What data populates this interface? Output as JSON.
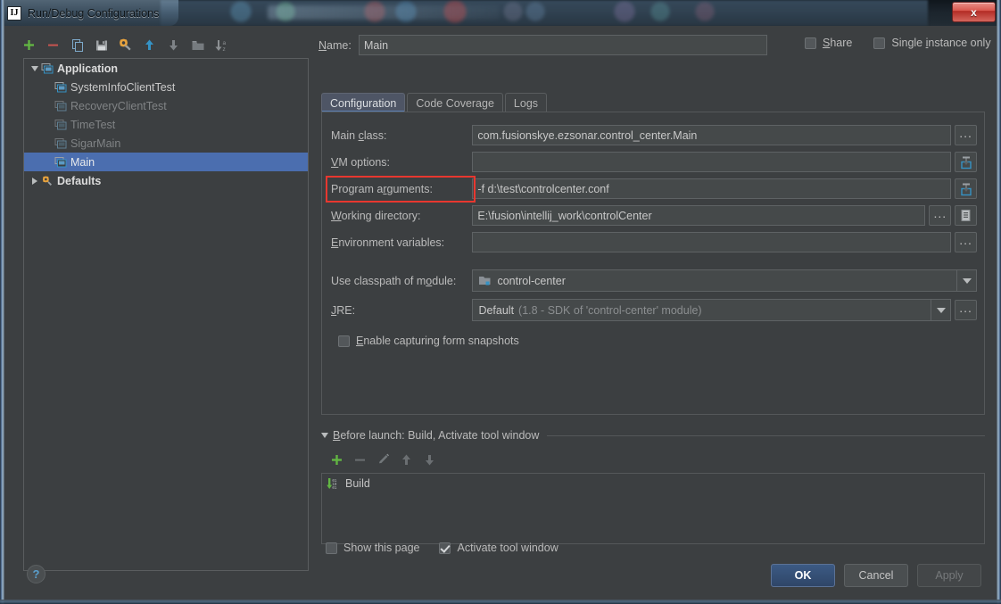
{
  "window": {
    "title": "Run/Debug Configurations",
    "logo_text": "IJ",
    "close_label": "x"
  },
  "toolbar": {
    "buttons": [
      {
        "name": "add-button",
        "icon": "plus-icon",
        "tooltip": "Add New Configuration"
      },
      {
        "name": "remove-button",
        "icon": "minus-icon",
        "tooltip": "Remove Configuration"
      },
      {
        "name": "copy-button",
        "icon": "copy-icon",
        "tooltip": "Copy Configuration"
      },
      {
        "name": "save-button",
        "icon": "save-icon",
        "tooltip": "Save Configuration"
      },
      {
        "name": "edit-defaults-button",
        "icon": "gear-wrench-icon",
        "tooltip": "Edit defaults"
      },
      {
        "name": "move-up-button",
        "icon": "arrow-up-icon",
        "tooltip": "Move Up"
      },
      {
        "name": "move-down-button",
        "icon": "arrow-down-icon",
        "tooltip": "Move Down"
      },
      {
        "name": "folder-button",
        "icon": "folder-icon",
        "tooltip": "Create New Folder"
      },
      {
        "name": "sort-button",
        "icon": "sort-alpha-icon",
        "tooltip": "Sort Configurations"
      }
    ]
  },
  "tree": {
    "nodes": [
      {
        "label": "Application",
        "level": 0,
        "expanded": true,
        "style": "bright",
        "icon": "application-icon",
        "selected": false
      },
      {
        "label": "SystemInfoClientTest",
        "level": 1,
        "style": "normal",
        "icon": "application-icon",
        "selected": false
      },
      {
        "label": "RecoveryClientTest",
        "level": 1,
        "style": "dim",
        "icon": "application-icon-dim",
        "selected": false
      },
      {
        "label": "TimeTest",
        "level": 1,
        "style": "dim",
        "icon": "application-icon-dim",
        "selected": false
      },
      {
        "label": "SigarMain",
        "level": 1,
        "style": "dim",
        "icon": "application-icon-dim",
        "selected": false
      },
      {
        "label": "Main",
        "level": 1,
        "style": "sel",
        "icon": "application-icon",
        "selected": true
      },
      {
        "label": "Defaults",
        "level": 0,
        "expanded": false,
        "style": "bright",
        "icon": "gear-wrench-icon",
        "selected": false
      }
    ]
  },
  "name_field": {
    "label_prefix": "",
    "label_mnemonic": "N",
    "label_suffix": "ame:",
    "value": "Main"
  },
  "header_checkboxes": [
    {
      "name": "share-checkbox",
      "label_prefix": "",
      "mnemonic": "S",
      "label_suffix": "hare",
      "checked": false
    },
    {
      "name": "single-instance-checkbox",
      "label_prefix": "Single ",
      "mnemonic": "i",
      "label_suffix": "nstance only",
      "checked": false
    }
  ],
  "tabs": [
    {
      "label": "Configuration",
      "active": true
    },
    {
      "label": "Code Coverage",
      "active": false
    },
    {
      "label": "Logs",
      "active": false
    }
  ],
  "form": {
    "main_class": {
      "label_prefix": "Main ",
      "mnemonic": "c",
      "label_suffix": "lass:",
      "value": "com.fusionskye.ezsonar.control_center.Main",
      "browse_label": "..."
    },
    "vm_options": {
      "label_prefix": "",
      "mnemonic": "V",
      "label_suffix": "M options:",
      "value": "",
      "expand_icon": "expand-editor-icon"
    },
    "program_arguments": {
      "label_prefix": "Program a",
      "mnemonic": "r",
      "label_suffix": "guments:",
      "value": "-f d:\\test\\controlcenter.conf",
      "expand_icon": "expand-editor-icon",
      "highlighted": true,
      "highlight_color": "#e8372f"
    },
    "working_directory": {
      "label_prefix": "",
      "mnemonic": "W",
      "label_suffix": "orking directory:",
      "value": "E:\\fusion\\intellij_work\\controlCenter",
      "browse_label": "...",
      "macro_icon": "macros-icon"
    },
    "environment_variables": {
      "label_prefix": "",
      "mnemonic": "E",
      "label_suffix": "nvironment variables:",
      "value": "",
      "browse_label": "..."
    },
    "classpath_module": {
      "label_prefix": "Use classpath of m",
      "mnemonic": "o",
      "label_suffix": "dule:",
      "value": "control-center",
      "icon": "module-icon"
    },
    "jre": {
      "label_prefix": "",
      "mnemonic": "J",
      "label_suffix": "RE:",
      "value": "Default",
      "value_hint": "(1.8 - SDK of 'control-center' module)",
      "browse_label": "..."
    },
    "form_snapshots": {
      "label_prefix": "",
      "mnemonic": "E",
      "label_suffix": "nable capturing form snapshots",
      "checked": false
    }
  },
  "before_launch": {
    "title": "Before launch: Build, Activate tool window",
    "title_mnemonic": "B",
    "title_rest": "efore launch: Build, Activate tool window",
    "toolbar": [
      {
        "name": "bl-add-button",
        "icon": "plus-icon",
        "enabled": true
      },
      {
        "name": "bl-remove-button",
        "icon": "minus-icon",
        "enabled": false
      },
      {
        "name": "bl-edit-button",
        "icon": "pencil-icon",
        "enabled": false
      },
      {
        "name": "bl-up-button",
        "icon": "arrow-up-icon",
        "enabled": false
      },
      {
        "name": "bl-down-button",
        "icon": "arrow-down-icon",
        "enabled": false
      }
    ],
    "items": [
      {
        "label": "Build",
        "icon": "build-icon"
      }
    ],
    "checkboxes": [
      {
        "name": "show-this-page-checkbox",
        "label": "Show this page",
        "checked": false
      },
      {
        "name": "activate-tool-window-checkbox",
        "label": "Activate tool window",
        "checked": true
      }
    ]
  },
  "footer": {
    "help_label": "?",
    "ok_label": "OK",
    "cancel_label": "Cancel",
    "apply_label": "Apply",
    "apply_enabled": false
  },
  "colors": {
    "background": "#3c3f41",
    "field_background": "#45494a",
    "selection": "#4b6eaf",
    "accent_blue": "#5a9ecb",
    "annotation_red": "#e8372f",
    "text": "#bbbbbb",
    "text_dim": "#808385"
  }
}
